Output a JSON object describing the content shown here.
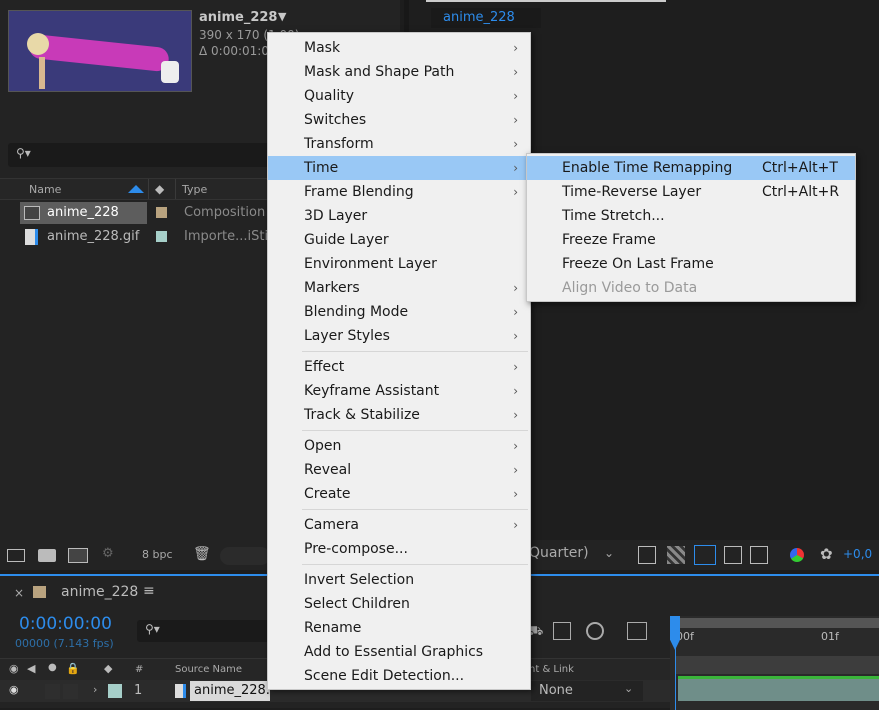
{
  "project": {
    "comp_name": "anime_228",
    "comp_size": "390 x 170 (1.00)",
    "comp_duration": "Δ 0:00:01:01",
    "columns": {
      "name": "Name",
      "type": "Type"
    },
    "items": [
      {
        "name": "anime_228",
        "type": "Composition",
        "label_color": "#b9a37f"
      },
      {
        "name": "anime_228.gif",
        "type": "Importe...iStill",
        "label_color": "#a6cfc9"
      }
    ],
    "bpc": "8 bpc"
  },
  "viewer": {
    "tab": "anime_228",
    "resolution": "Quarter)",
    "exposure": "+0,0"
  },
  "context_menu": {
    "items": [
      {
        "label": "Mask",
        "submenu": true
      },
      {
        "label": "Mask and Shape Path",
        "submenu": true
      },
      {
        "label": "Quality",
        "submenu": true
      },
      {
        "label": "Switches",
        "submenu": true
      },
      {
        "label": "Transform",
        "submenu": true
      },
      {
        "label": "Time",
        "submenu": true,
        "highlighted": true
      },
      {
        "label": "Frame Blending",
        "submenu": true
      },
      {
        "label": "3D Layer",
        "submenu": false
      },
      {
        "label": "Guide Layer",
        "submenu": false
      },
      {
        "label": "Environment Layer",
        "submenu": false
      },
      {
        "label": "Markers",
        "submenu": true
      },
      {
        "label": "Blending Mode",
        "submenu": true
      },
      {
        "label": "Layer Styles",
        "submenu": true
      },
      {
        "label": "Effect",
        "submenu": true
      },
      {
        "label": "Keyframe Assistant",
        "submenu": true
      },
      {
        "label": "Track & Stabilize",
        "submenu": true
      },
      {
        "label": "Open",
        "submenu": true
      },
      {
        "label": "Reveal",
        "submenu": true
      },
      {
        "label": "Create",
        "submenu": true
      },
      {
        "label": "Camera",
        "submenu": true
      },
      {
        "label": "Pre-compose...",
        "submenu": false
      },
      {
        "label": "Invert Selection",
        "submenu": false
      },
      {
        "label": "Select Children",
        "submenu": false
      },
      {
        "label": "Rename",
        "submenu": false
      },
      {
        "label": "Add to Essential Graphics",
        "submenu": false
      },
      {
        "label": "Scene Edit Detection...",
        "submenu": false
      }
    ]
  },
  "time_submenu": {
    "items": [
      {
        "label": "Enable Time Remapping",
        "shortcut": "Ctrl+Alt+T",
        "highlighted": true
      },
      {
        "label": "Time-Reverse Layer",
        "shortcut": "Ctrl+Alt+R"
      },
      {
        "label": "Time Stretch...",
        "shortcut": ""
      },
      {
        "label": "Freeze Frame",
        "shortcut": ""
      },
      {
        "label": "Freeze On Last Frame",
        "shortcut": ""
      },
      {
        "label": "Align Video to Data",
        "shortcut": "",
        "disabled": true
      }
    ]
  },
  "timeline": {
    "tab": "anime_228",
    "timecode": "0:00:00:00",
    "frames": "00000 (7.143 fps)",
    "col_number": "#",
    "col_source": "Source Name",
    "col_parent": "nt & Link",
    "layer_number": "1",
    "layer_name": "anime_228.gif",
    "parent_value": "None",
    "ruler": [
      "00f",
      "01f"
    ]
  }
}
